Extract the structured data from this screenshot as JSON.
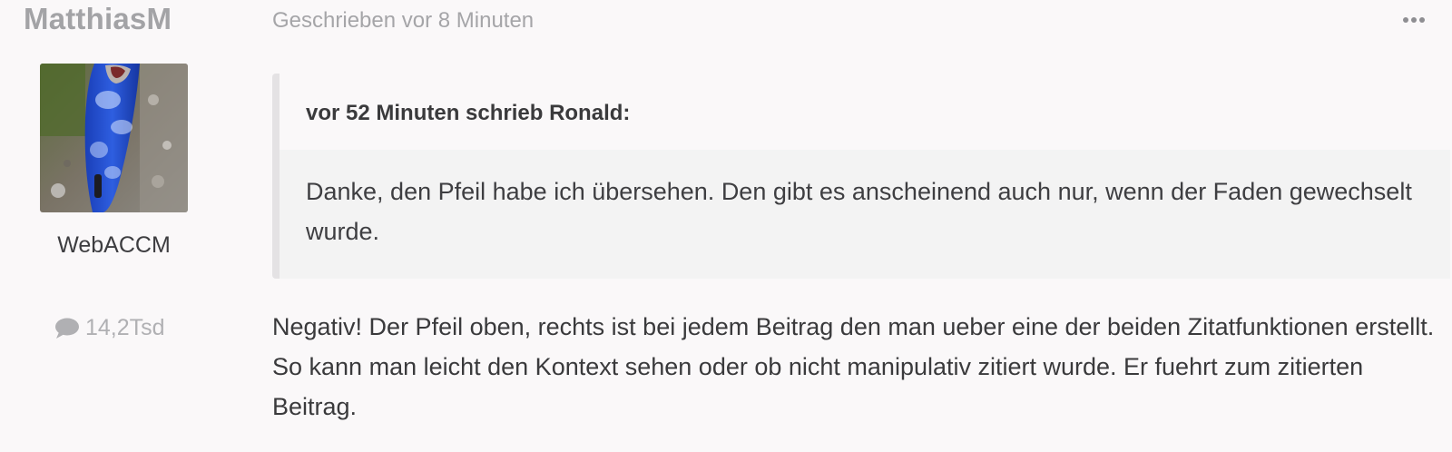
{
  "author": {
    "name": "MatthiasM",
    "group": "WebACCM",
    "post_count": "14,2Tsd"
  },
  "post": {
    "date": "Geschrieben vor 8 Minuten",
    "content": "Negativ! Der Pfeil oben, rechts ist bei jedem Beitrag den man ueber eine der beiden Zitatfunktionen erstellt. So kann man leicht den Kontext sehen oder ob nicht manipulativ zitiert wurde. Er fuehrt zum zitierten Beitrag."
  },
  "quote": {
    "citation": "vor 52 Minuten schrieb Ronald:",
    "body": "Danke, den Pfeil habe ich übersehen. Den gibt es anscheinend auch nur, wenn der Faden gewechselt wurde."
  },
  "icons": {
    "more": "more-options-icon",
    "comment": "comment-bubble-icon"
  },
  "colors": {
    "background": "#faf8f9",
    "quote_body_bg": "#f3f3f3",
    "quote_border": "#e4e2e4",
    "muted_text": "#a3a3a6"
  }
}
